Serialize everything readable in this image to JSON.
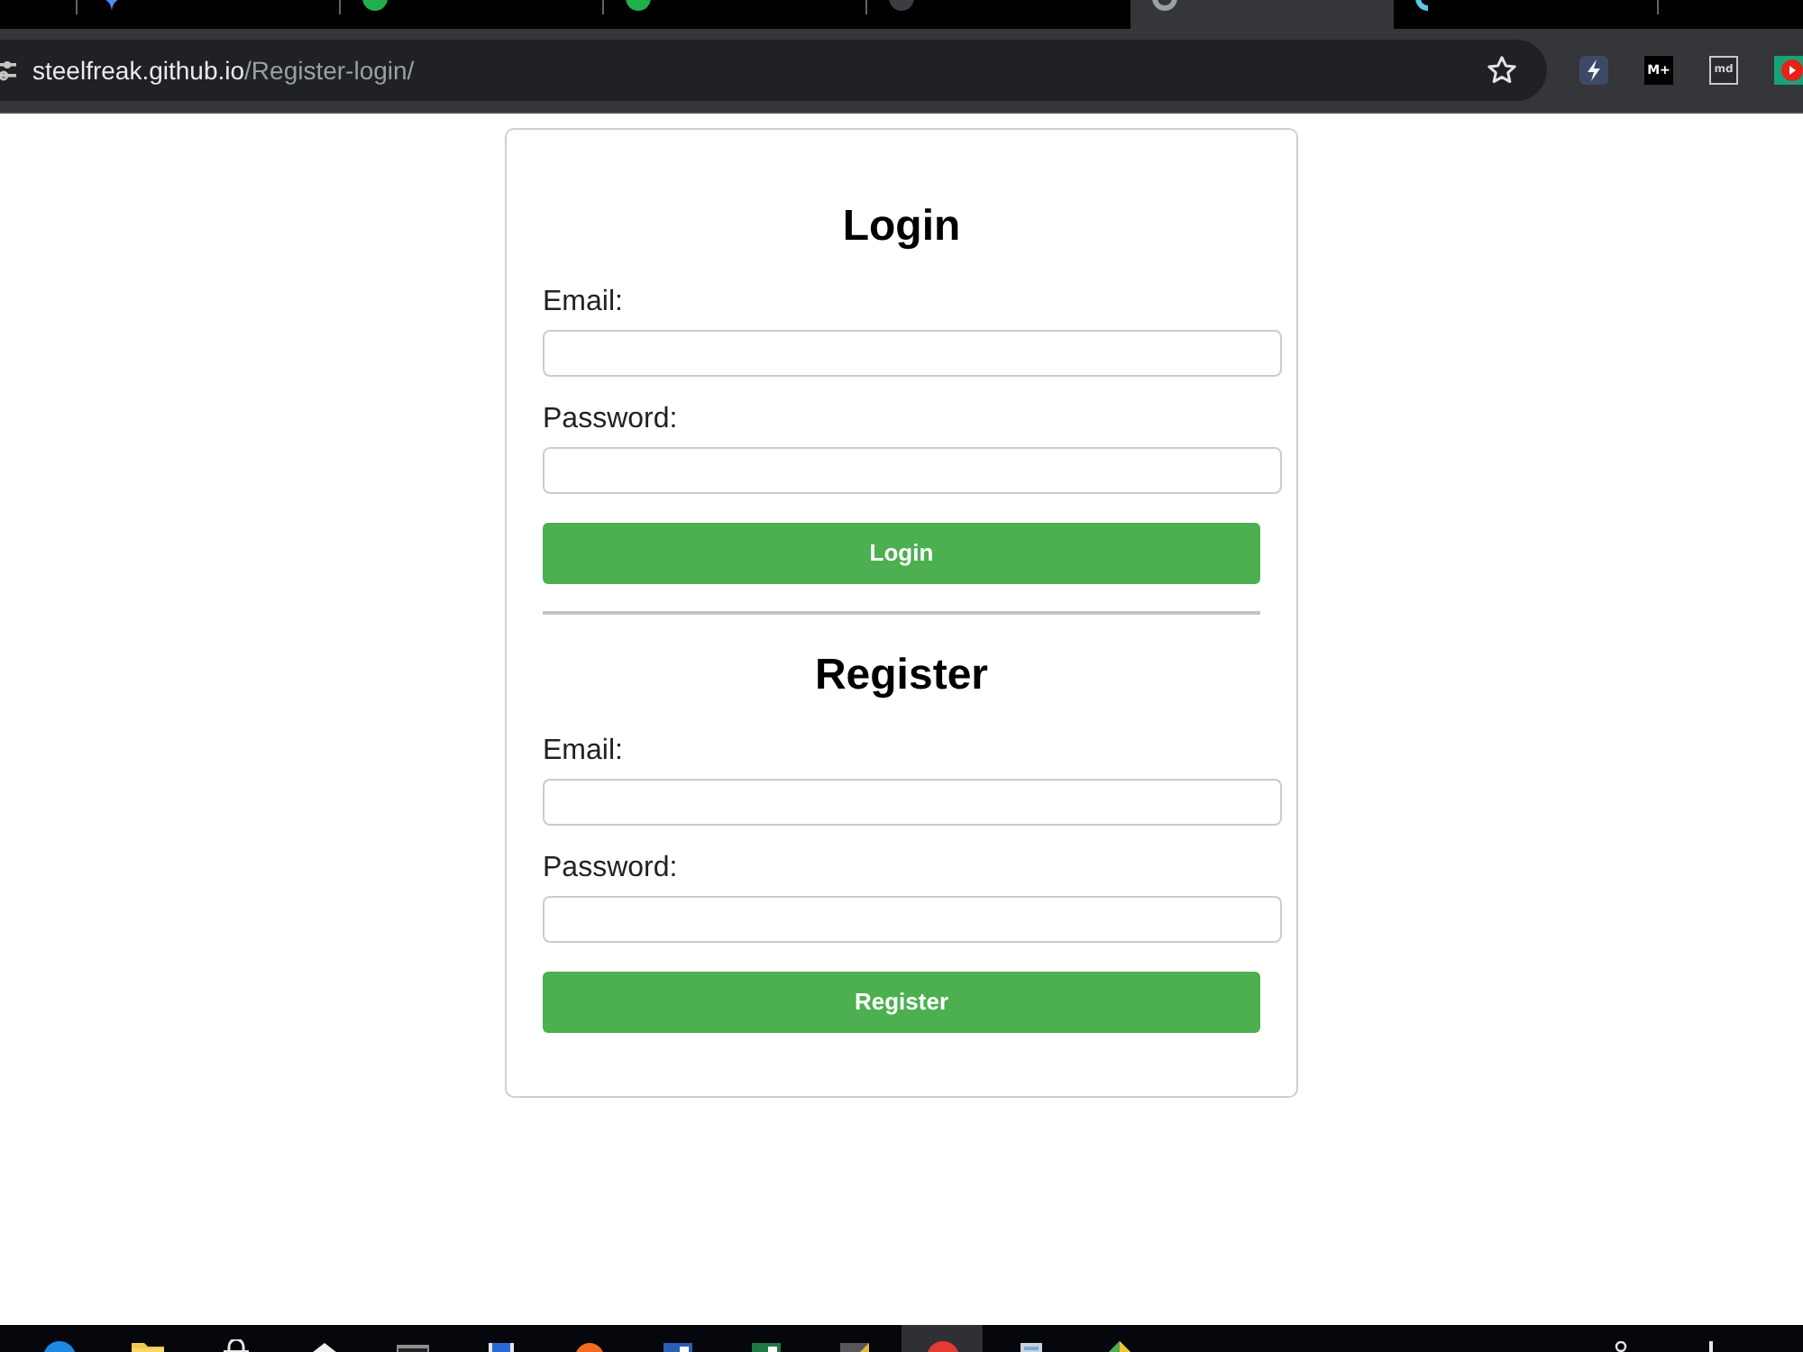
{
  "browser": {
    "tabs": [
      {
        "selected": false
      },
      {
        "selected": false
      },
      {
        "selected": false
      },
      {
        "selected": false
      },
      {
        "selected": true
      },
      {
        "selected": false
      }
    ],
    "address": {
      "host": "steelfreak.github.io",
      "path": "/Register-login/"
    },
    "extensions": [
      {
        "kind": "bolt"
      },
      {
        "kind": "text",
        "text": "M+"
      },
      {
        "kind": "outlined",
        "text": "md"
      },
      {
        "kind": "play"
      }
    ]
  },
  "sections": [
    {
      "title": "Login",
      "fields": [
        {
          "label": "Email:"
        },
        {
          "label": "Password:"
        }
      ],
      "button": "Login"
    },
    {
      "title": "Register",
      "fields": [
        {
          "label": "Email:"
        },
        {
          "label": "Password:"
        }
      ],
      "button": "Register"
    }
  ],
  "taskbar": {
    "apps": [
      {
        "selected": false
      },
      {
        "selected": false
      },
      {
        "selected": false
      },
      {
        "selected": false
      },
      {
        "selected": false
      },
      {
        "selected": false
      },
      {
        "selected": false
      },
      {
        "selected": false
      },
      {
        "selected": false
      },
      {
        "selected": false
      },
      {
        "selected": true
      },
      {
        "selected": false
      },
      {
        "selected": false
      }
    ]
  }
}
